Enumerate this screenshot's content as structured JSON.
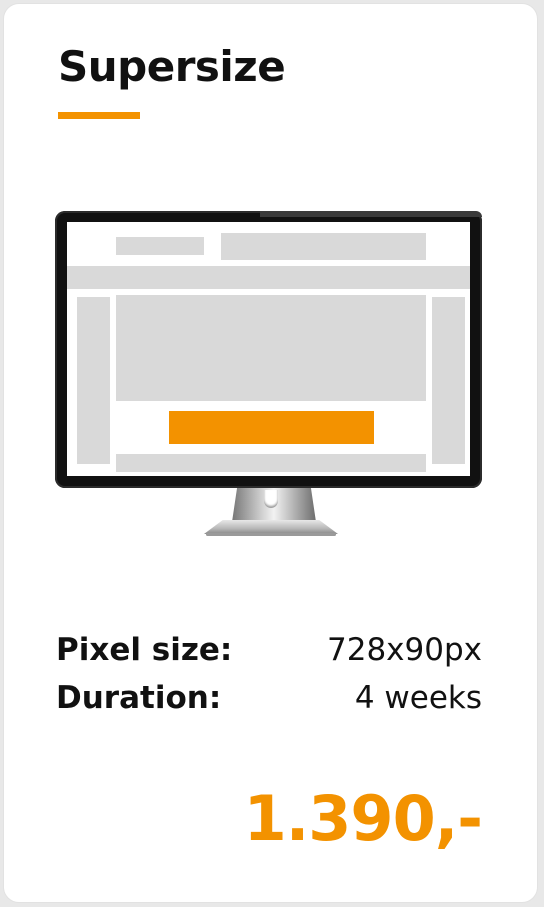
{
  "card": {
    "title": "Supersize",
    "accent_color": "#f39200"
  },
  "illustration": {
    "icon": "monitor-icon",
    "highlighted_slot": "ad-banner"
  },
  "specs": [
    {
      "label": "Pixel size:",
      "value": "728x90px"
    },
    {
      "label": "Duration:",
      "value": "4 weeks"
    }
  ],
  "price": "1.390,-"
}
